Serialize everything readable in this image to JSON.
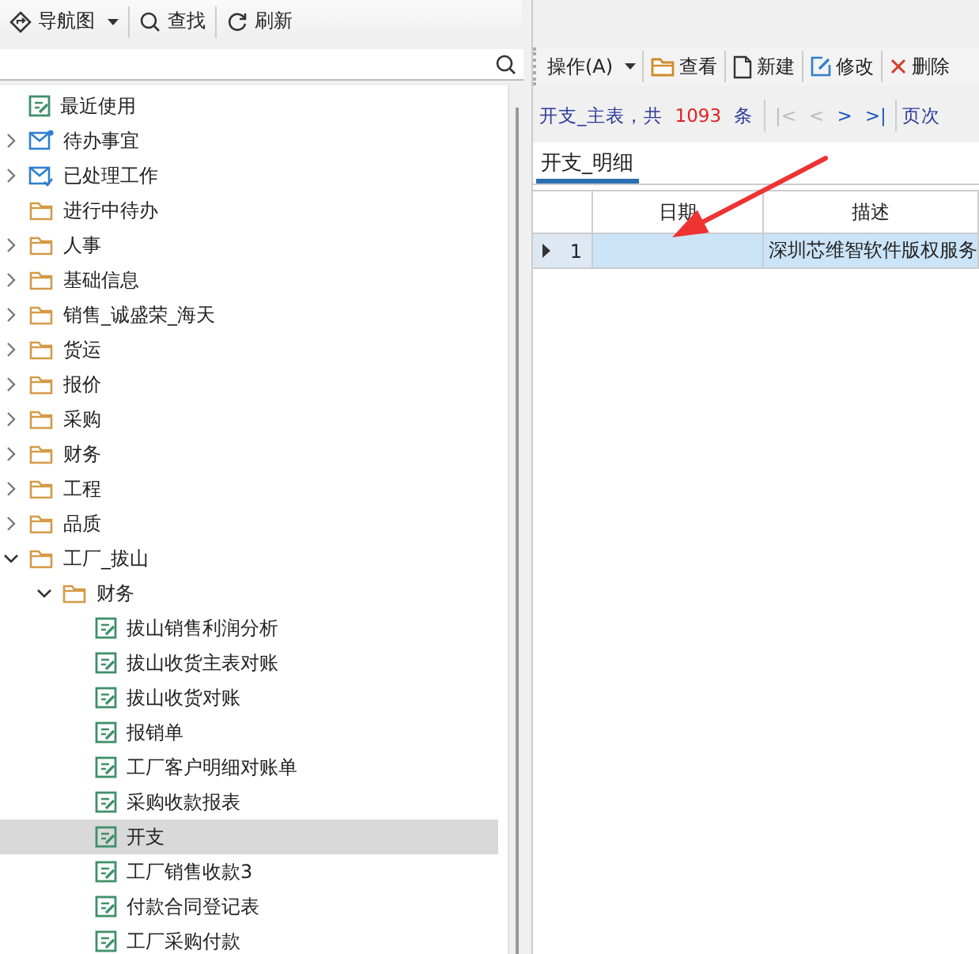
{
  "nav_toolbar": [
    {
      "kind": "nav",
      "label": "导航图",
      "dropdown": true
    },
    {
      "kind": "search",
      "label": "查找",
      "dropdown": false
    },
    {
      "kind": "refresh",
      "label": "刷新",
      "dropdown": false
    }
  ],
  "tree": [
    {
      "label": "最近使用",
      "kind": "form",
      "selected": false
    },
    {
      "label": "待办事宜",
      "kind": "inbox",
      "expanded": false,
      "selected": false
    },
    {
      "label": "已处理工作",
      "kind": "done",
      "expanded": false,
      "selected": false
    },
    {
      "label": "进行中待办",
      "kind": "folder",
      "selected": false
    },
    {
      "label": "人事",
      "kind": "folder",
      "expanded": false,
      "selected": false
    },
    {
      "label": "基础信息",
      "kind": "folder",
      "expanded": false,
      "selected": false
    },
    {
      "label": "销售_诚盛荣_海天",
      "kind": "folder",
      "expanded": false,
      "selected": false
    },
    {
      "label": "货运",
      "kind": "folder",
      "expanded": false,
      "selected": false
    },
    {
      "label": "报价",
      "kind": "folder",
      "expanded": false,
      "selected": false
    },
    {
      "label": "采购",
      "kind": "folder",
      "expanded": false,
      "selected": false
    },
    {
      "label": "财务",
      "kind": "folder",
      "expanded": false,
      "selected": false
    },
    {
      "label": "工程",
      "kind": "folder",
      "expanded": false,
      "selected": false
    },
    {
      "label": "品质",
      "kind": "folder",
      "expanded": false,
      "selected": false
    },
    {
      "label": "工厂_拔山",
      "kind": "folder",
      "expanded": true,
      "selected": false,
      "children": [
        {
          "label": "财务",
          "kind": "folder",
          "expanded": true,
          "selected": false,
          "children": [
            {
              "label": "拔山销售利润分析",
              "kind": "form",
              "selected": false
            },
            {
              "label": "拔山收货主表对账",
              "kind": "form",
              "selected": false
            },
            {
              "label": "拔山收货对账",
              "kind": "form",
              "selected": false
            },
            {
              "label": "报销单",
              "kind": "form",
              "selected": false
            },
            {
              "label": "工厂客户明细对账单",
              "kind": "form",
              "selected": false
            },
            {
              "label": "采购收款报表",
              "kind": "form",
              "selected": false
            },
            {
              "label": "开支",
              "kind": "form",
              "selected": true
            },
            {
              "label": "工厂销售收款3",
              "kind": "form",
              "selected": false
            },
            {
              "label": "付款合同登记表",
              "kind": "form",
              "selected": false
            },
            {
              "label": "工厂采购付款",
              "kind": "form",
              "selected": false
            }
          ]
        }
      ]
    }
  ],
  "actions": [
    {
      "kind": "menu",
      "label": "操作(A)"
    },
    {
      "kind": "view",
      "label": "查看"
    },
    {
      "kind": "new",
      "label": "新建"
    },
    {
      "kind": "edit",
      "label": "修改"
    },
    {
      "kind": "delete",
      "label": "删除"
    }
  ],
  "pager": {
    "prefix": "开支_主表，共",
    "count": "1093",
    "unit": "条",
    "nav": [
      {
        "symbol": "|<",
        "disabled": true
      },
      {
        "symbol": "<",
        "disabled": true
      },
      {
        "symbol": ">",
        "disabled": false
      },
      {
        "symbol": ">|",
        "disabled": false
      }
    ],
    "page_label": "页次"
  },
  "tabs": [
    {
      "label": "开支_明细",
      "selected": true
    }
  ],
  "grid": {
    "columns": [
      "日期",
      "描述"
    ],
    "rows": [
      {
        "number": "1",
        "current": true,
        "selected": true,
        "cells": [
          null,
          "深圳芯维智软件版权服务"
        ]
      }
    ]
  },
  "annotations": [
    {
      "kind": "arrow"
    }
  ]
}
